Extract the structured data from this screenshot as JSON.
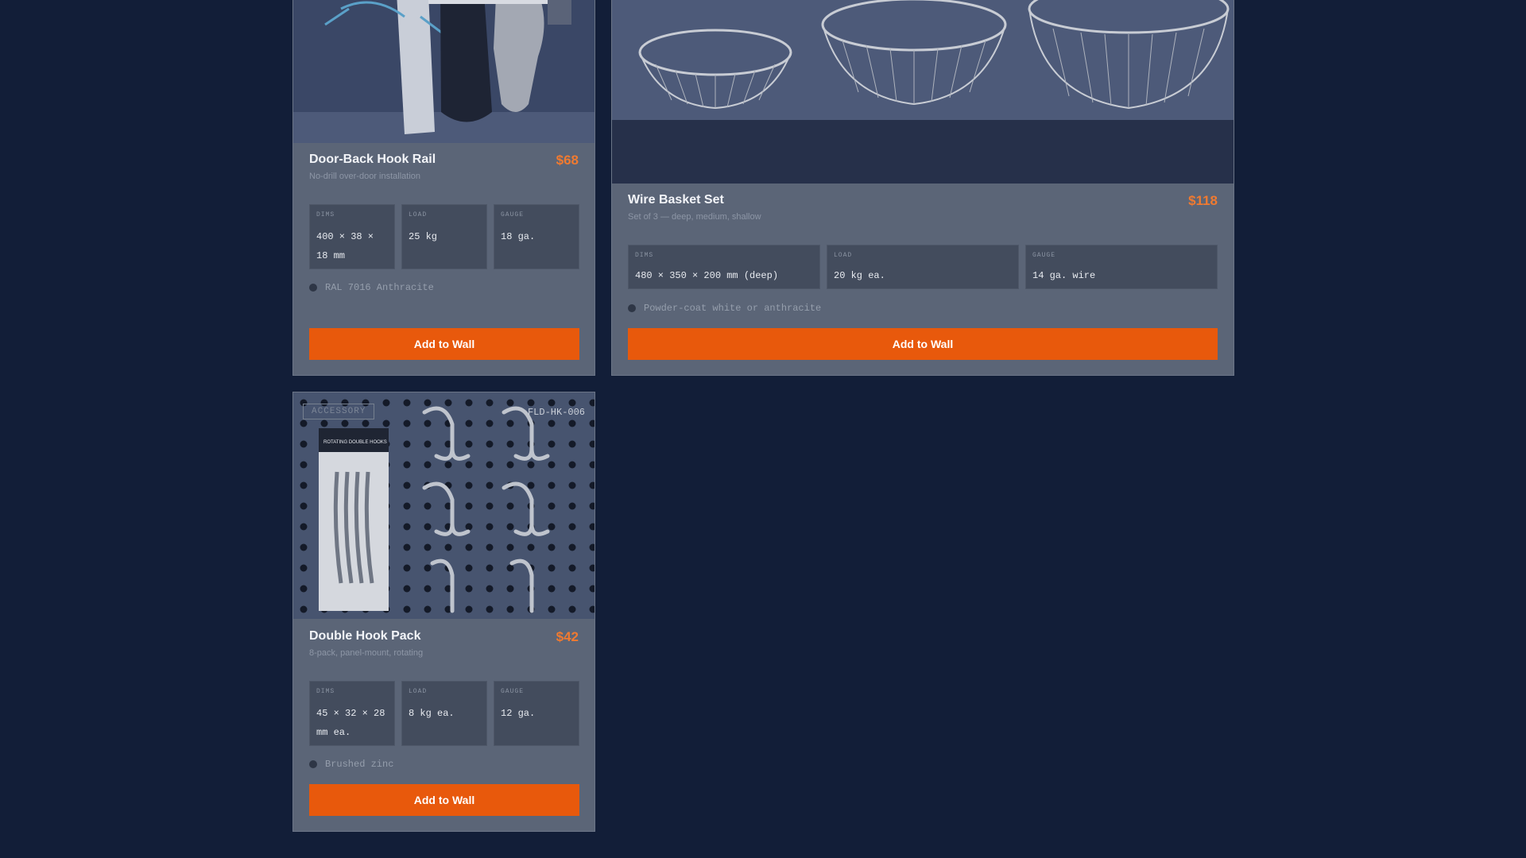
{
  "products": [
    {
      "name": "Door-Back Hook Rail",
      "subtitle": "No-drill over-door installation",
      "price": "$68",
      "specs": [
        {
          "label": "DIMS",
          "value": "400 × 38 × 18 mm"
        },
        {
          "label": "LOAD",
          "value": "25 kg"
        },
        {
          "label": "GAUGE",
          "value": "18 ga."
        }
      ],
      "finish": "RAL 7016 Anthracite",
      "button": "Add to Wall"
    },
    {
      "name": "Wire Basket Set",
      "subtitle": "Set of 3 — deep, medium, shallow",
      "price": "$118",
      "specs": [
        {
          "label": "DIMS",
          "value": "480 × 350 × 200 mm (deep)"
        },
        {
          "label": "LOAD",
          "value": "20 kg ea."
        },
        {
          "label": "GAUGE",
          "value": "14 ga. wire"
        }
      ],
      "finish": "Powder-coat white or anthracite",
      "button": "Add to Wall"
    },
    {
      "name": "Double Hook Pack",
      "subtitle": "8-pack, panel-mount, rotating",
      "price": "$42",
      "badge": "ACCESSORY",
      "sku": "FLD-HK-006",
      "package_label": "ROTATING DOUBLE HOOKS",
      "specs": [
        {
          "label": "DIMS",
          "value": "45 × 32 × 28 mm ea."
        },
        {
          "label": "LOAD",
          "value": "8 kg ea."
        },
        {
          "label": "GAUGE",
          "value": "12 ga."
        }
      ],
      "finish": "Brushed zinc",
      "button": "Add to Wall"
    }
  ],
  "colors": {
    "page_bg": "#121e38",
    "card_bg": "#5b6577",
    "spec_bg": "#434c5d",
    "accent": "#e8590c",
    "price": "#f07a30"
  }
}
